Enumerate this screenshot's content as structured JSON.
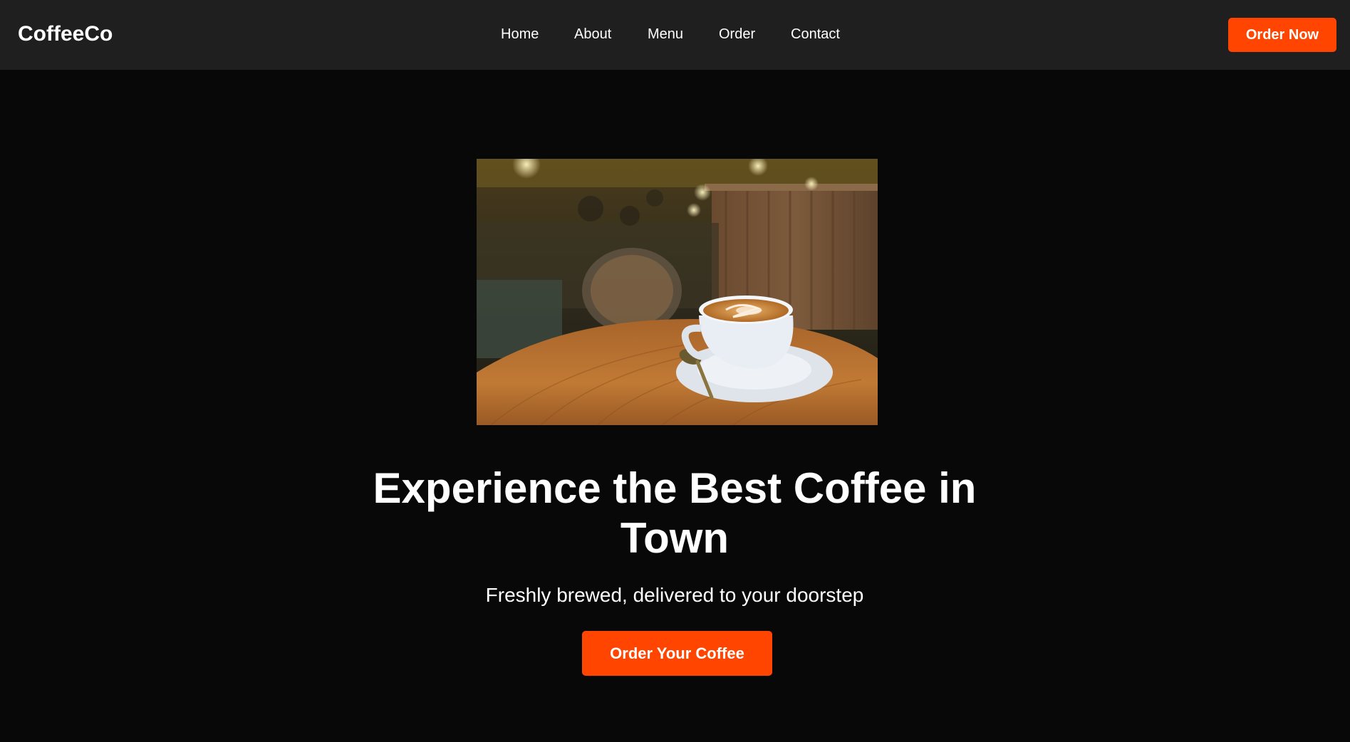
{
  "brand": {
    "name": "CoffeeCo"
  },
  "nav": {
    "links": [
      "Home",
      "About",
      "Menu",
      "Order",
      "Contact"
    ],
    "cta_label": "Order Now"
  },
  "hero": {
    "image_subject": "latte with latte art in a white cup on a saucer with a spoon, on a round wooden table in a dim café",
    "title": "Experience the Best Coffee in Town",
    "subtitle": "Freshly brewed, delivered to your doorstep",
    "cta_label": "Order Your Coffee"
  },
  "colors": {
    "accent": "#ff4500",
    "navbar_bg": "#1f1f1f",
    "page_bg": "#080808",
    "text": "#ffffff"
  }
}
